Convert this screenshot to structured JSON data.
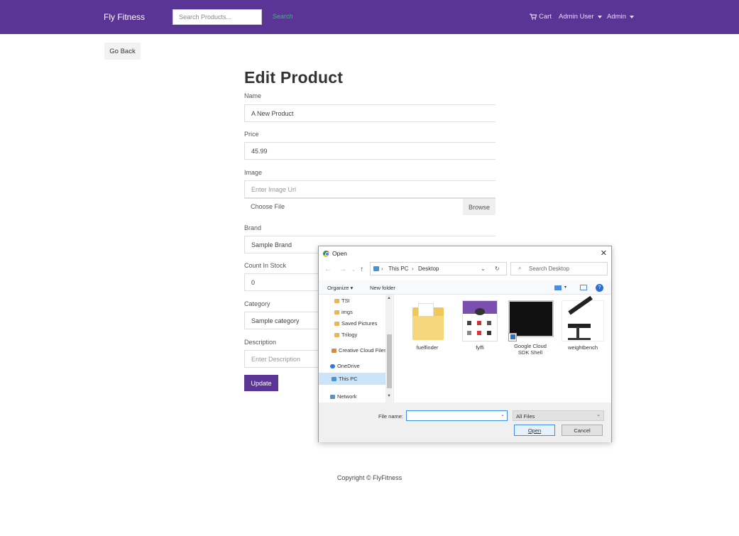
{
  "navbar": {
    "brand": "Fly Fitness",
    "search_placeholder": "Search Products...",
    "search_button": "Search",
    "search_ghost_text": "",
    "cart_label": "Cart",
    "user_menu": "Admin User",
    "admin_menu": "Admin"
  },
  "page": {
    "go_back": "Go Back",
    "title": "Edit Product",
    "name_label": "Name",
    "name_value": "A New Product",
    "price_label": "Price",
    "price_value": "45.99",
    "image_label": "Image",
    "image_placeholder": "Enter Image Url",
    "choose_file": "Choose File",
    "browse": "Browse",
    "brand_label": "Brand",
    "brand_value": "Sample Brand",
    "count_label": "Count In Stock",
    "count_value": "0",
    "category_label": "Category",
    "category_value": "Sample category",
    "description_label": "Description",
    "description_placeholder": "Enter Description",
    "update_button": "Update"
  },
  "footer": {
    "copyright": "Copyright © FlyFitness"
  },
  "dialog": {
    "title": "Open",
    "close": "✕",
    "path": [
      "This PC",
      "Desktop"
    ],
    "search_placeholder": "Search Desktop",
    "organize": "Organize",
    "new_folder": "New folder",
    "tree": [
      {
        "label": "TSI",
        "kind": "folder"
      },
      {
        "label": "imgs",
        "kind": "folder"
      },
      {
        "label": "Saved Pictures",
        "kind": "folder"
      },
      {
        "label": "Trilogy",
        "kind": "folder"
      },
      {
        "label": "Creative Cloud Files",
        "kind": "cloud-folder"
      },
      {
        "label": "OneDrive",
        "kind": "onedrive"
      },
      {
        "label": "This PC",
        "kind": "pc"
      },
      {
        "label": "Network",
        "kind": "network"
      }
    ],
    "files": [
      {
        "name": "fuelfinder",
        "kind": "folder"
      },
      {
        "name": "fyffi",
        "kind": "screenshot"
      },
      {
        "name": "Google Cloud SDK Shell",
        "kind": "shortcut"
      },
      {
        "name": "weightbench",
        "kind": "image"
      }
    ],
    "file_name_label": "File name:",
    "file_name_value": "",
    "file_type": "All Files",
    "open_button": "Open",
    "cancel_button": "Cancel"
  }
}
